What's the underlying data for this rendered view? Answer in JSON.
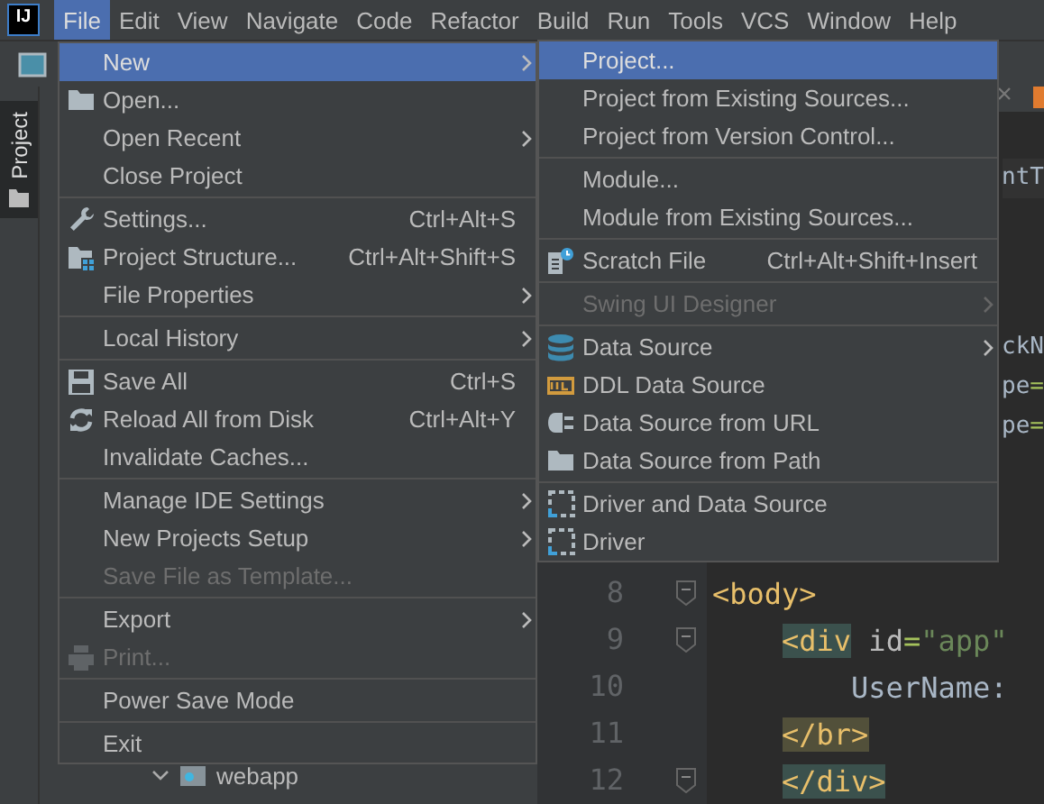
{
  "menubar": {
    "logo": "IJ",
    "items": [
      {
        "label": "File",
        "selected": true
      },
      {
        "label": "Edit",
        "selected": false
      },
      {
        "label": "View",
        "selected": false
      },
      {
        "label": "Navigate",
        "selected": false
      },
      {
        "label": "Code",
        "selected": false
      },
      {
        "label": "Refactor",
        "selected": false
      },
      {
        "label": "Build",
        "selected": false
      },
      {
        "label": "Run",
        "selected": false
      },
      {
        "label": "Tools",
        "selected": false
      },
      {
        "label": "VCS",
        "selected": false
      },
      {
        "label": "Window",
        "selected": false
      },
      {
        "label": "Help",
        "selected": false
      }
    ]
  },
  "sidebar": {
    "tabs": [
      {
        "label": "Project",
        "selected": true
      }
    ]
  },
  "project_tree": {
    "items": [
      {
        "label": "webapp",
        "expanded": true
      }
    ]
  },
  "editor": {
    "fragments": [
      {
        "tokens": [
          {
            "text": "ntT",
            "kind": "text"
          }
        ]
      },
      {
        "tokens": [
          {
            "text": "ckN",
            "kind": "text"
          }
        ]
      },
      {
        "tokens": [
          {
            "text": "pe",
            "kind": "text"
          },
          {
            "text": "=",
            "kind": "punct"
          }
        ]
      },
      {
        "tokens": [
          {
            "text": "pe",
            "kind": "text"
          },
          {
            "text": "=",
            "kind": "punct"
          }
        ]
      }
    ],
    "lines": [
      {
        "number": "8",
        "fold": true,
        "tokens": [
          {
            "text": "<body>",
            "kind": "tag"
          }
        ],
        "children": [
          {
            "number": "9",
            "fold": true,
            "tokens": [
              {
                "text": "<div",
                "kind": "tag-match"
              },
              {
                "text": " id",
                "kind": "attr"
              },
              {
                "text": "=",
                "kind": "punct"
              },
              {
                "text": "\"app\"",
                "kind": "string"
              }
            ],
            "children": [
              {
                "number": "10",
                "fold": false,
                "tokens": [
                  {
                    "text": "UserName:",
                    "kind": "text"
                  }
                ]
              }
            ]
          },
          {
            "number": "11",
            "fold": false,
            "tokens": [
              {
                "text": "</br>",
                "kind": "tag-warn"
              }
            ]
          },
          {
            "number": "12",
            "fold": true,
            "tokens": [
              {
                "text": "</div>",
                "kind": "tag-match"
              }
            ]
          }
        ]
      }
    ]
  },
  "file_menu": {
    "items": [
      {
        "kind": "item",
        "label": "New",
        "submenu": true,
        "selected": true,
        "disabled": false
      },
      {
        "kind": "item",
        "label": "Open...",
        "selected": false,
        "disabled": false
      },
      {
        "kind": "item",
        "label": "Open Recent",
        "submenu": true,
        "selected": false,
        "disabled": false
      },
      {
        "kind": "item",
        "label": "Close Project",
        "selected": false,
        "disabled": false
      },
      {
        "kind": "separator"
      },
      {
        "kind": "item",
        "label": "Settings...",
        "shortcut": "Ctrl+Alt+S",
        "selected": false,
        "disabled": false
      },
      {
        "kind": "item",
        "label": "Project Structure...",
        "shortcut": "Ctrl+Alt+Shift+S",
        "selected": false,
        "disabled": false
      },
      {
        "kind": "item",
        "label": "File Properties",
        "submenu": true,
        "selected": false,
        "disabled": false
      },
      {
        "kind": "separator"
      },
      {
        "kind": "item",
        "label": "Local History",
        "submenu": true,
        "selected": false,
        "disabled": false
      },
      {
        "kind": "separator"
      },
      {
        "kind": "item",
        "label": "Save All",
        "shortcut": "Ctrl+S",
        "selected": false,
        "disabled": false
      },
      {
        "kind": "item",
        "label": "Reload All from Disk",
        "shortcut": "Ctrl+Alt+Y",
        "selected": false,
        "disabled": false
      },
      {
        "kind": "item",
        "label": "Invalidate Caches...",
        "selected": false,
        "disabled": false
      },
      {
        "kind": "separator"
      },
      {
        "kind": "item",
        "label": "Manage IDE Settings",
        "submenu": true,
        "selected": false,
        "disabled": false
      },
      {
        "kind": "item",
        "label": "New Projects Setup",
        "submenu": true,
        "selected": false,
        "disabled": false
      },
      {
        "kind": "item",
        "label": "Save File as Template...",
        "selected": false,
        "disabled": true
      },
      {
        "kind": "separator"
      },
      {
        "kind": "item",
        "label": "Export",
        "submenu": true,
        "selected": false,
        "disabled": false
      },
      {
        "kind": "item",
        "label": "Print...",
        "selected": false,
        "disabled": true
      },
      {
        "kind": "separator"
      },
      {
        "kind": "item",
        "label": "Power Save Mode",
        "selected": false,
        "disabled": false
      },
      {
        "kind": "separator"
      },
      {
        "kind": "item",
        "label": "Exit",
        "selected": false,
        "disabled": false
      }
    ]
  },
  "new_submenu": {
    "items": [
      {
        "kind": "item",
        "label": "Project...",
        "selected": true,
        "disabled": false
      },
      {
        "kind": "item",
        "label": "Project from Existing Sources...",
        "selected": false,
        "disabled": false
      },
      {
        "kind": "item",
        "label": "Project from Version Control...",
        "selected": false,
        "disabled": false
      },
      {
        "kind": "separator"
      },
      {
        "kind": "item",
        "label": "Module...",
        "selected": false,
        "disabled": false
      },
      {
        "kind": "item",
        "label": "Module from Existing Sources...",
        "selected": false,
        "disabled": false
      },
      {
        "kind": "separator"
      },
      {
        "kind": "item",
        "label": "Scratch File",
        "shortcut": "Ctrl+Alt+Shift+Insert",
        "selected": false,
        "disabled": false
      },
      {
        "kind": "separator"
      },
      {
        "kind": "item",
        "label": "Swing UI Designer",
        "submenu": true,
        "selected": false,
        "disabled": true
      },
      {
        "kind": "separator"
      },
      {
        "kind": "item",
        "label": "Data Source",
        "submenu": true,
        "selected": false,
        "disabled": false
      },
      {
        "kind": "item",
        "label": "DDL Data Source",
        "selected": false,
        "disabled": false
      },
      {
        "kind": "item",
        "label": "Data Source from URL",
        "selected": false,
        "disabled": false
      },
      {
        "kind": "item",
        "label": "Data Source from Path",
        "selected": false,
        "disabled": false
      },
      {
        "kind": "separator"
      },
      {
        "kind": "item",
        "label": "Driver and Data Source",
        "selected": false,
        "disabled": false
      },
      {
        "kind": "item",
        "label": "Driver",
        "selected": false,
        "disabled": false
      }
    ]
  }
}
